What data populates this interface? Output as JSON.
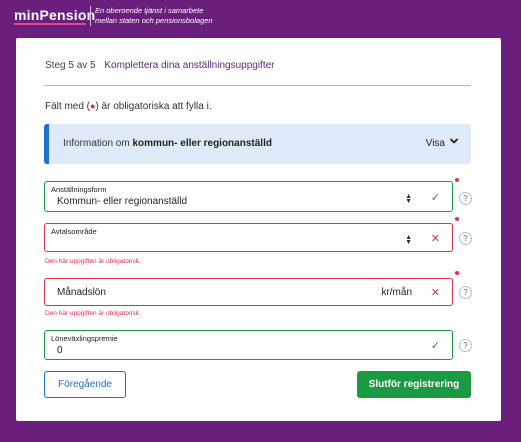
{
  "header": {
    "logo": "minPension",
    "tagline_line1": "En oberoende tjänst i samarbete",
    "tagline_line2": "mellan staten och pensionsbolagen"
  },
  "step": {
    "count": "Steg 5 av 5",
    "title": "Komplettera dina anställningsuppgifter"
  },
  "required_note": {
    "before": "Fält med (",
    "dot": "●",
    "after": ") är obligatoriska att fylla i."
  },
  "info": {
    "prefix": "Information om ",
    "bold": "kommun- eller regionanställd",
    "show_label": "Visa",
    "chevron_icon": "chevron-down-icon"
  },
  "fields": {
    "employment_form": {
      "label": "Anställningsform",
      "value": "Kommun- eller regionanställd",
      "status": "valid"
    },
    "agreement_area": {
      "label": "Avtalsområde",
      "value": "",
      "status": "error",
      "error": "Den här uppgiften är obligatorisk."
    },
    "monthly_salary": {
      "placeholder": "Månadslön",
      "unit": "kr/mån",
      "status": "error",
      "error": "Den här uppgiften är obligatorisk."
    },
    "salary_exchange": {
      "label": "Löneväxlingspremie",
      "value": "0",
      "status": "valid"
    }
  },
  "icons": {
    "check": "✓",
    "cross": "✕",
    "help": "?",
    "chevron": "❯"
  },
  "buttons": {
    "previous": "Föregående",
    "finish": "Slutför registrering"
  },
  "colors": {
    "background": "#6b1f7c",
    "primary_blue": "#1f6fd1",
    "success_green": "#1b9a44",
    "error_red": "#d9354a",
    "info_bg": "#dfeaf8"
  }
}
